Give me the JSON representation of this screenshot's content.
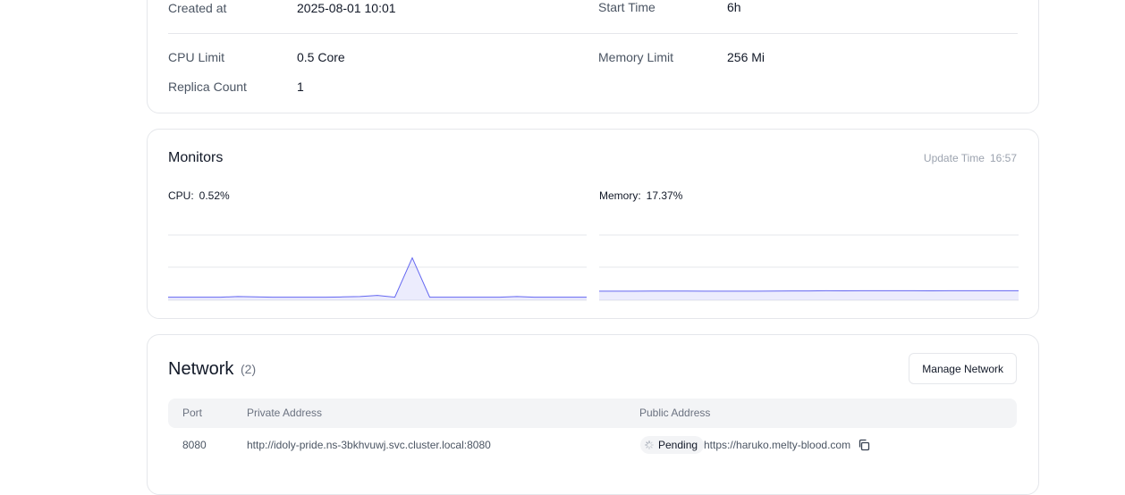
{
  "details": {
    "created_at_label": "Created at",
    "created_at_value": "2025-08-01 10:01",
    "start_time_label": "Start Time",
    "start_time_value": "6h",
    "cpu_limit_label": "CPU Limit",
    "cpu_limit_value": "0.5 Core",
    "memory_limit_label": "Memory Limit",
    "memory_limit_value": "256 Mi",
    "replica_count_label": "Replica Count",
    "replica_count_value": "1"
  },
  "monitors": {
    "title": "Monitors",
    "update_time_label": "Update Time",
    "update_time_value": "16:57",
    "cpu": {
      "label": "CPU:",
      "value": "0.52%",
      "color": "#6366f1",
      "series": [
        0.5,
        0.5,
        0.5,
        0.5,
        0.6,
        0.55,
        0.5,
        0.5,
        0.5,
        0.5,
        0.55,
        0.6,
        0.8,
        0.5,
        7.0,
        0.5,
        0.5,
        0.5,
        0.5,
        0.5,
        0.6,
        0.5,
        0.5,
        0.5,
        0.5
      ]
    },
    "memory": {
      "label": "Memory:",
      "value": "17.37%",
      "color": "#6366f1",
      "series": [
        16.5,
        16.6,
        16.5,
        16.8,
        16.9,
        16.7,
        16.5,
        16.5,
        16.5,
        16.6,
        16.8,
        17.0,
        17.1,
        17.3,
        17.2,
        17.4,
        17.4,
        17.3,
        17.3,
        17.2,
        17.3,
        17.3,
        17.3,
        17.3,
        17.37
      ]
    }
  },
  "network": {
    "title": "Network",
    "count": "(2)",
    "manage_button": "Manage Network",
    "columns": {
      "port": "Port",
      "private": "Private Address",
      "public": "Public Address"
    },
    "rows": [
      {
        "port": "8080",
        "private": "http://idoly-pride.ns-3bkhvuwj.svc.cluster.local:8080",
        "status": "Pending",
        "public": "https://haruko.melty-blood.com"
      }
    ]
  }
}
